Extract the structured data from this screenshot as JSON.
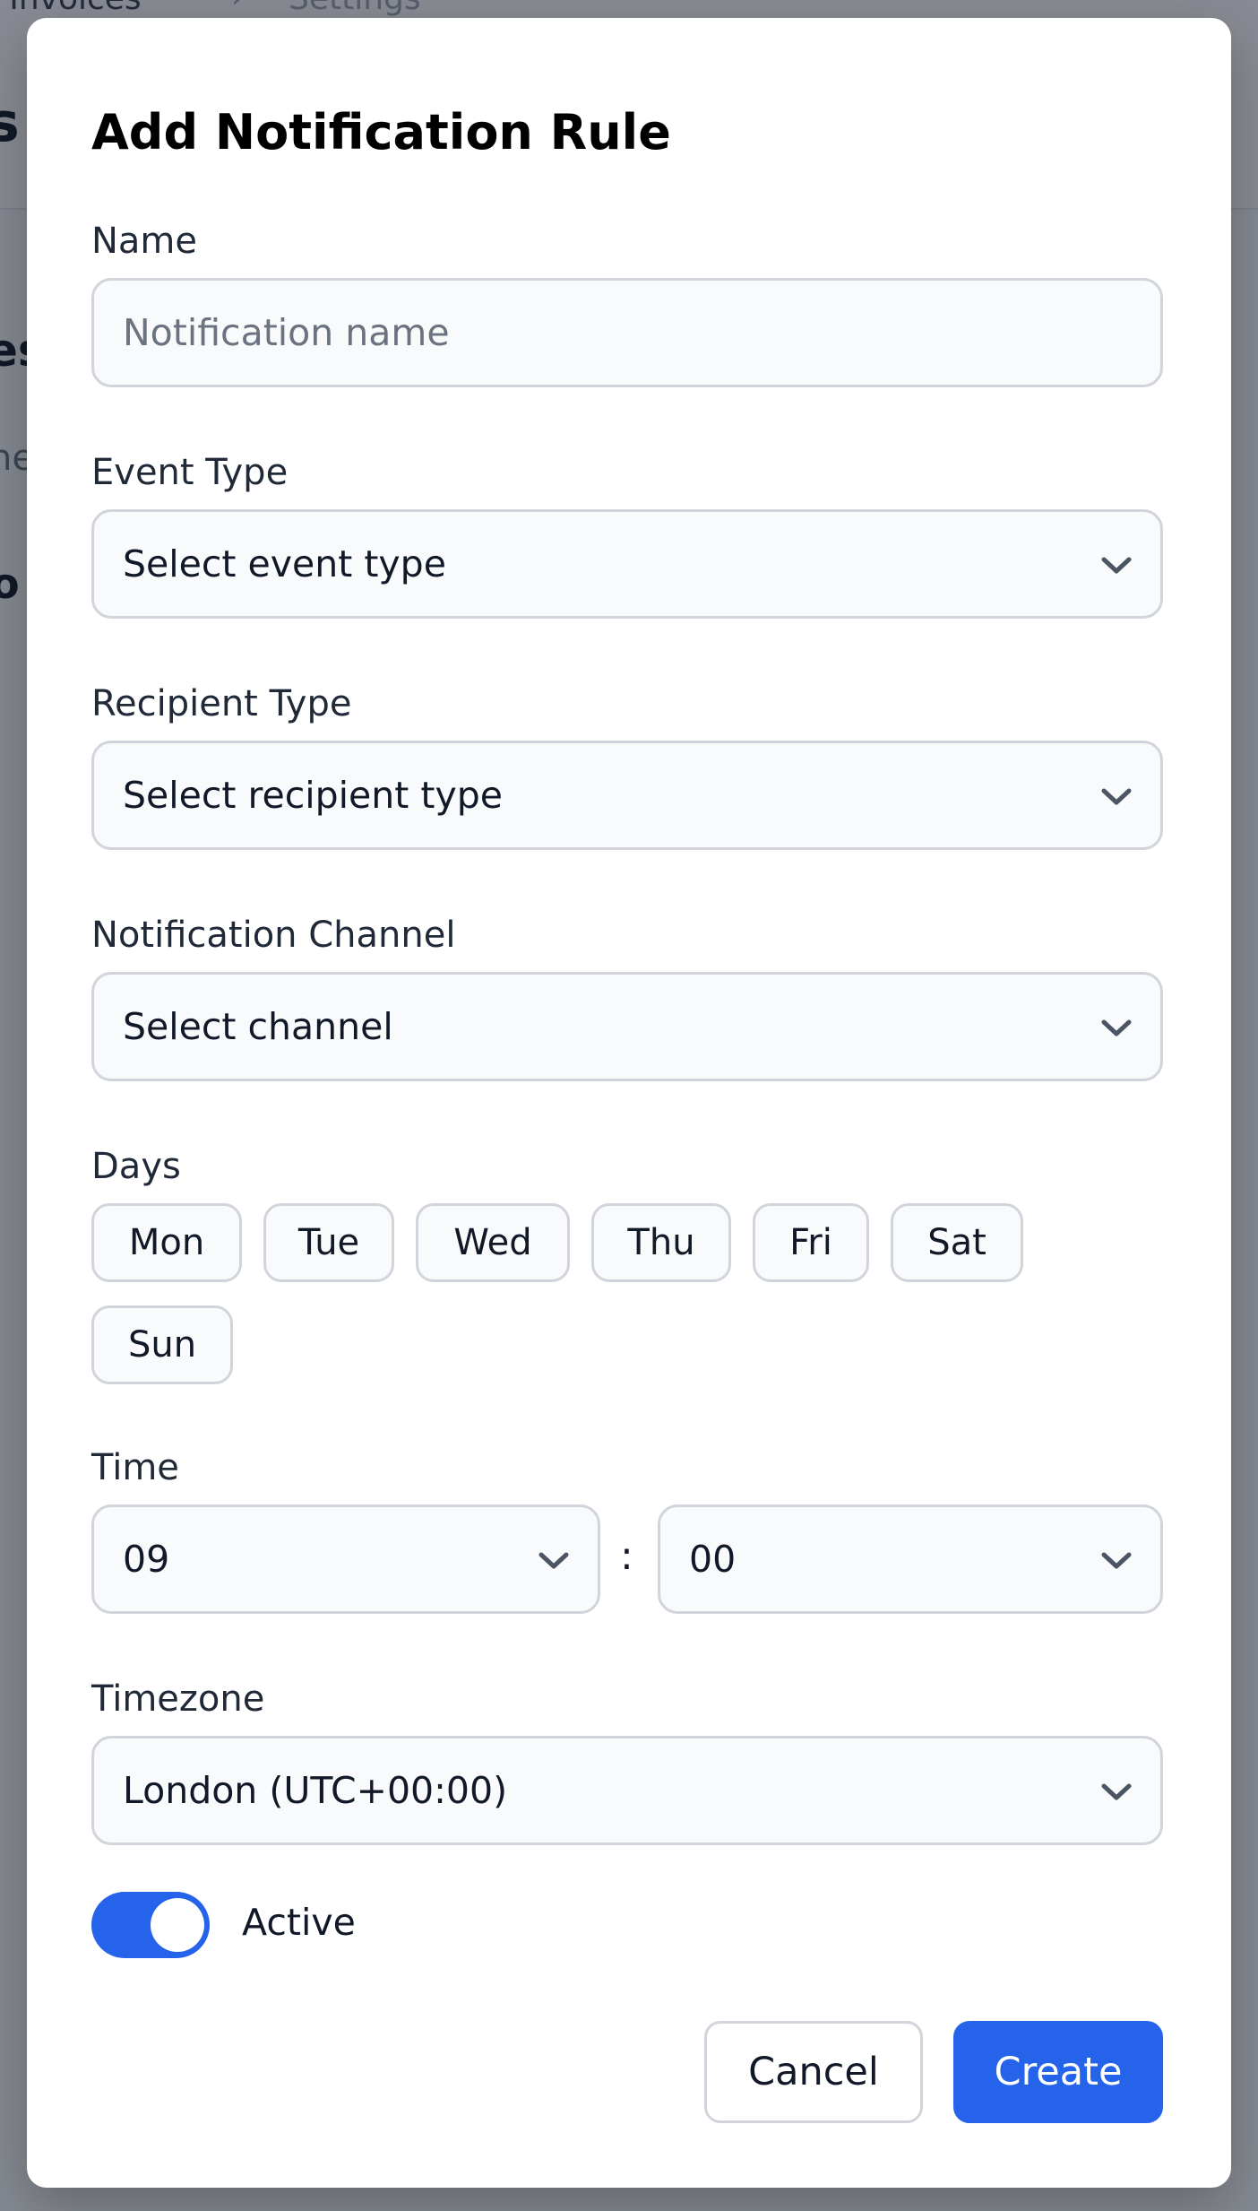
{
  "background": {
    "breadcrumb_1": "s Invoices",
    "breadcrumb_sep": "›",
    "breadcrumb_2": "Settings",
    "page_title_fragment": "s",
    "section_fragment_1": "es",
    "section_fragment_2": "ne",
    "section_fragment_3": "o"
  },
  "modal": {
    "title": "Add Notification Rule",
    "name": {
      "label": "Name",
      "placeholder": "Notification name"
    },
    "event_type": {
      "label": "Event Type",
      "value": "Select event type"
    },
    "recipient_type": {
      "label": "Recipient Type",
      "value": "Select recipient type"
    },
    "channel": {
      "label": "Notification Channel",
      "value": "Select channel"
    },
    "days": {
      "label": "Days",
      "items": [
        "Mon",
        "Tue",
        "Wed",
        "Thu",
        "Fri",
        "Sat",
        "Sun"
      ]
    },
    "time": {
      "label": "Time",
      "hour": "09",
      "separator": ":",
      "minute": "00"
    },
    "timezone": {
      "label": "Timezone",
      "value": "London (UTC+00:00)"
    },
    "active": {
      "label": "Active",
      "on": true
    },
    "buttons": {
      "cancel": "Cancel",
      "create": "Create"
    }
  },
  "colors": {
    "accent": "#2563eb",
    "border": "#d1d5db",
    "field_bg": "#f9fafb",
    "overlay": "rgba(17,24,39,0.5)"
  },
  "icons": {
    "select": "chevron-down-icon"
  }
}
